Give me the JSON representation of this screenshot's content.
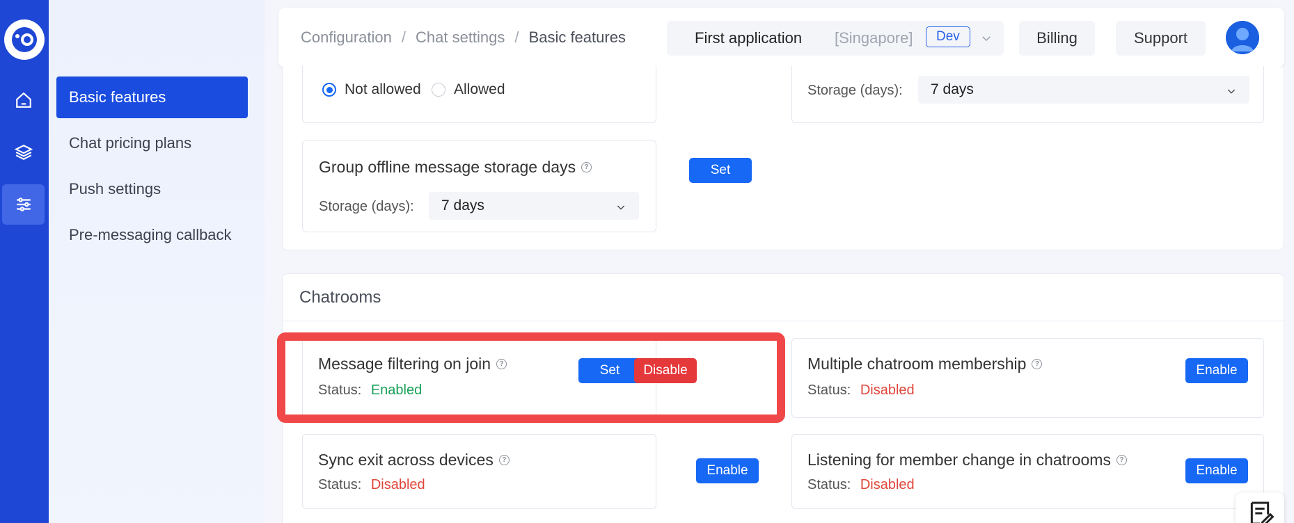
{
  "rail": {
    "logo_icon": "app-logo-icon",
    "items": [
      {
        "icon": "home-icon"
      },
      {
        "icon": "layers-icon"
      },
      {
        "icon": "sliders-icon",
        "active": true
      }
    ]
  },
  "submenu": {
    "items": [
      {
        "label": "Basic features",
        "active": true
      },
      {
        "label": "Chat pricing plans"
      },
      {
        "label": "Push settings"
      },
      {
        "label": "Pre-messaging callback"
      }
    ]
  },
  "header": {
    "breadcrumb": [
      "Configuration",
      "Chat settings",
      "Basic features"
    ],
    "separator": "/",
    "app_name": "First application",
    "app_region": "[Singapore]",
    "app_env": "Dev",
    "billing_label": "Billing",
    "support_label": "Support"
  },
  "top_panel": {
    "radio_not_allowed": "Not allowed",
    "radio_allowed": "Allowed",
    "storage_label_right": "Storage (days):",
    "storage_value_right": "7 days",
    "group_offline": {
      "title": "Group offline message storage days",
      "set_label": "Set",
      "storage_label": "Storage (days):",
      "storage_value": "7 days"
    }
  },
  "chatrooms": {
    "title": "Chatrooms",
    "status_prefix": "Status:",
    "cards": [
      {
        "title": "Message filtering on join",
        "status": "Enabled",
        "set_label": "Set",
        "action_label": "Disable"
      },
      {
        "title": "Multiple chatroom membership",
        "status": "Disabled",
        "action_label": "Enable"
      },
      {
        "title": "Sync exit across devices",
        "status": "Disabled",
        "action_label": "Enable"
      },
      {
        "title": "Listening for member change in chatrooms",
        "status": "Disabled",
        "action_label": "Enable"
      }
    ]
  },
  "colors": {
    "rail": "#1f47d6",
    "primary": "#1668f5",
    "danger": "#e5383b",
    "enabled": "#18a058",
    "disabled": "#e0453a",
    "highlight": "#f04848"
  }
}
